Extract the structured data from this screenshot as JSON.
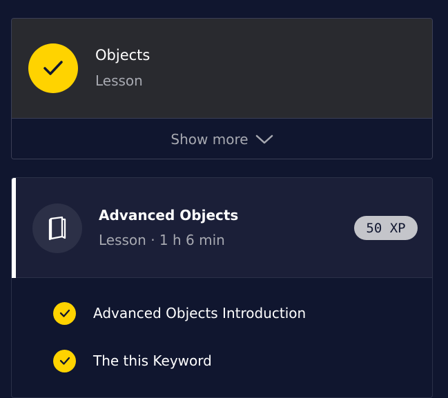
{
  "completed_lesson": {
    "title": "Objects",
    "type": "Lesson",
    "status_icon": "checkmark-icon",
    "show_more_label": "Show more"
  },
  "current_lesson": {
    "title": "Advanced Objects",
    "meta": "Lesson · 1 h 6 min",
    "xp": "50 XP",
    "icon": "book-icon",
    "items": [
      {
        "label": "Advanced Objects Introduction",
        "completed": true
      },
      {
        "label": "The this Keyword",
        "completed": true
      }
    ]
  },
  "colors": {
    "accent_yellow": "#ffd300",
    "background": "#10162f",
    "card_dark": "#292a2f",
    "header_navy": "#1b1f38"
  }
}
